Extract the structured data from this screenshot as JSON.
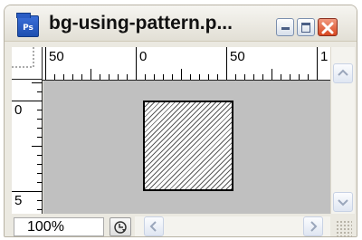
{
  "window": {
    "title": "bg-using-pattern.p...",
    "app_icon_text": "Ps",
    "app_icon_name": "photoshop-doc-icon"
  },
  "rulers": {
    "horizontal_labels": [
      "50",
      "0",
      "50",
      "1"
    ],
    "vertical_labels": [
      "0",
      "5"
    ]
  },
  "statusbar": {
    "zoom_value": "100%"
  },
  "colors": {
    "canvas_background": "#c0c0c0",
    "close_button": "#d8471f",
    "app_icon": "#2a5cc4"
  }
}
